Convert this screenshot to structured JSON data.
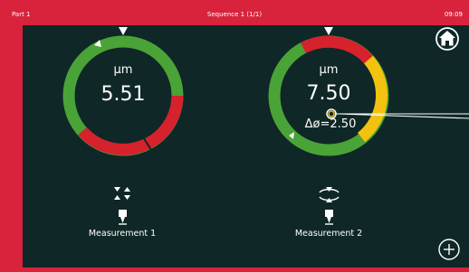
{
  "titlebar": {
    "left": "Part 1",
    "center": "Sequence 1 (1/1)",
    "right": "09:09"
  },
  "gauges": [
    {
      "unit": "µm",
      "value": "5.51",
      "label": "Measurement 1",
      "icon": "clamp-arrows-icon"
    },
    {
      "unit": "µm",
      "value": "7.50",
      "delta": "Δø=2.50",
      "label": "Measurement 2",
      "icon": "ring-gauge-icon"
    }
  ],
  "icons": {
    "home": "home-icon",
    "add": "add-icon"
  },
  "colors": {
    "frame": "#d9233d",
    "panel": "#0f2727",
    "green": "#4aa336",
    "red": "#d5222c",
    "yellow": "#f3c10f"
  }
}
